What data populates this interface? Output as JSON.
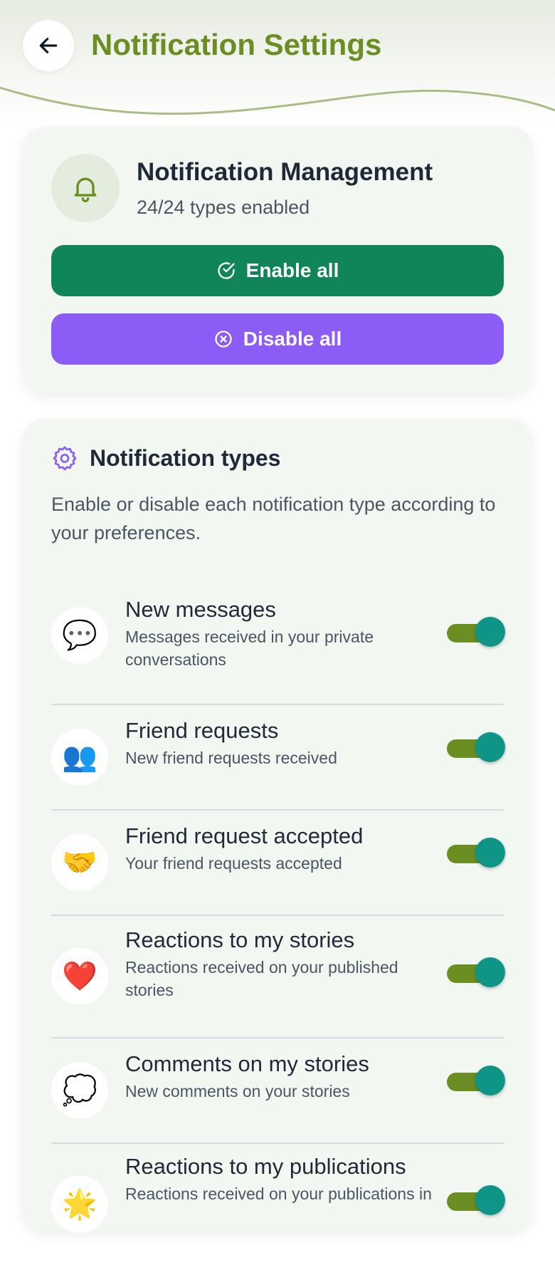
{
  "header": {
    "title": "Notification Settings",
    "back_icon": "arrow-left-icon"
  },
  "management": {
    "title": "Notification Management",
    "status": "24/24 types enabled",
    "enable_all_label": "Enable all",
    "disable_all_label": "Disable all",
    "enable_color": "#108559",
    "disable_color": "#8b5cf6"
  },
  "types": {
    "title": "Notification types",
    "description": "Enable or disable each notification type according to your preferences.",
    "items": [
      {
        "icon": "💬",
        "icon_name": "speech-bubble-icon",
        "title": "New messages",
        "description": "Messages received in your private conversations",
        "enabled": true
      },
      {
        "icon": "👥",
        "icon_name": "people-icon",
        "title": "Friend requests",
        "description": "New friend requests received",
        "enabled": true
      },
      {
        "icon": "🤝",
        "icon_name": "handshake-icon",
        "title": "Friend request accepted",
        "description": "Your friend requests accepted",
        "enabled": true
      },
      {
        "icon": "❤️",
        "icon_name": "heart-icon",
        "title": "Reactions to my stories",
        "description": "Reactions received on your published stories",
        "enabled": true
      },
      {
        "icon": "💭",
        "icon_name": "thought-bubble-icon",
        "title": "Comments on my stories",
        "description": "New comments on your stories",
        "enabled": true
      },
      {
        "icon": "🌟",
        "icon_name": "star-icon",
        "title": "Reactions to my publications",
        "description": "Reactions received on your publications in",
        "enabled": true
      }
    ]
  },
  "colors": {
    "accent": "#6b8e23",
    "toggle_knob": "#0f9488",
    "toggle_track": "#6b8e23"
  }
}
